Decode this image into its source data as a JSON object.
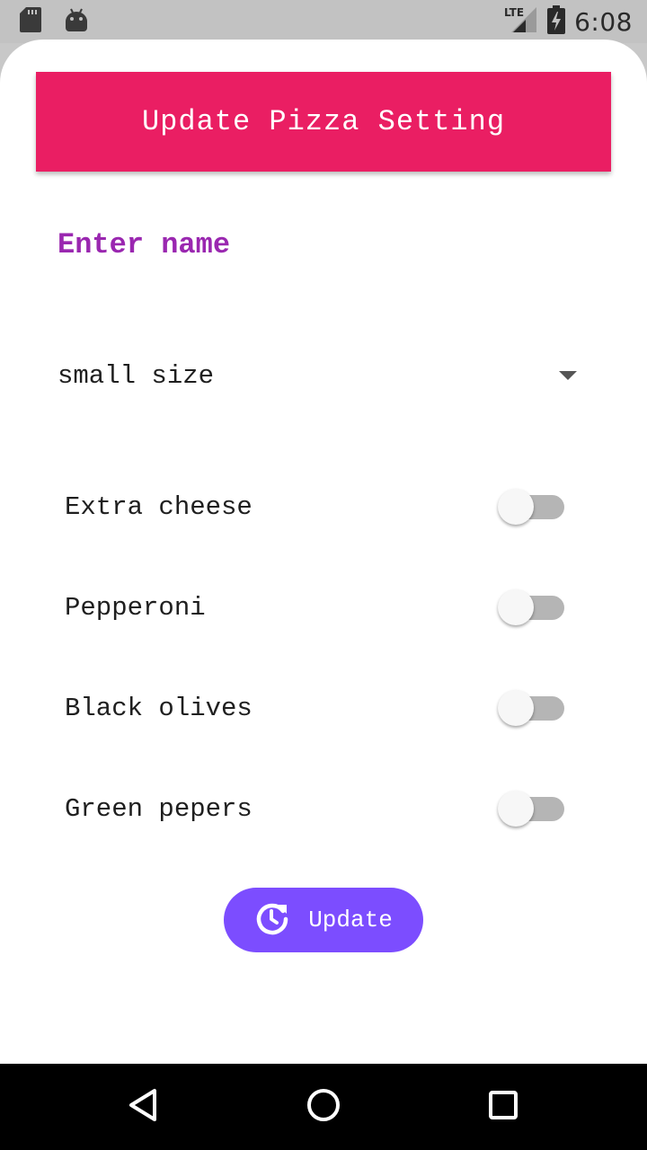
{
  "status_bar": {
    "time": "6:08",
    "network": "LTE",
    "icons": [
      "sd-card-icon",
      "android-icon",
      "lte-signal-icon",
      "battery-charging-icon"
    ]
  },
  "header": {
    "title": "Update Pizza Setting",
    "color": "#ea1e63"
  },
  "form": {
    "name_placeholder": "Enter name",
    "name_value": "",
    "size_selected": "small size",
    "options": [
      {
        "label": "Extra cheese",
        "enabled": false
      },
      {
        "label": "Pepperoni",
        "enabled": false
      },
      {
        "label": "Black olives",
        "enabled": false
      },
      {
        "label": "Green pepers",
        "enabled": false
      }
    ]
  },
  "actions": {
    "update_label": "Update",
    "update_icon": "update-history-icon",
    "button_color": "#7c4dff"
  },
  "nav_bar": {
    "icons": [
      "back-icon",
      "home-icon",
      "recents-icon"
    ]
  },
  "colors": {
    "accent": "#ea1e63",
    "input_text": "#9a27b0",
    "primary_button": "#7c4dff"
  }
}
